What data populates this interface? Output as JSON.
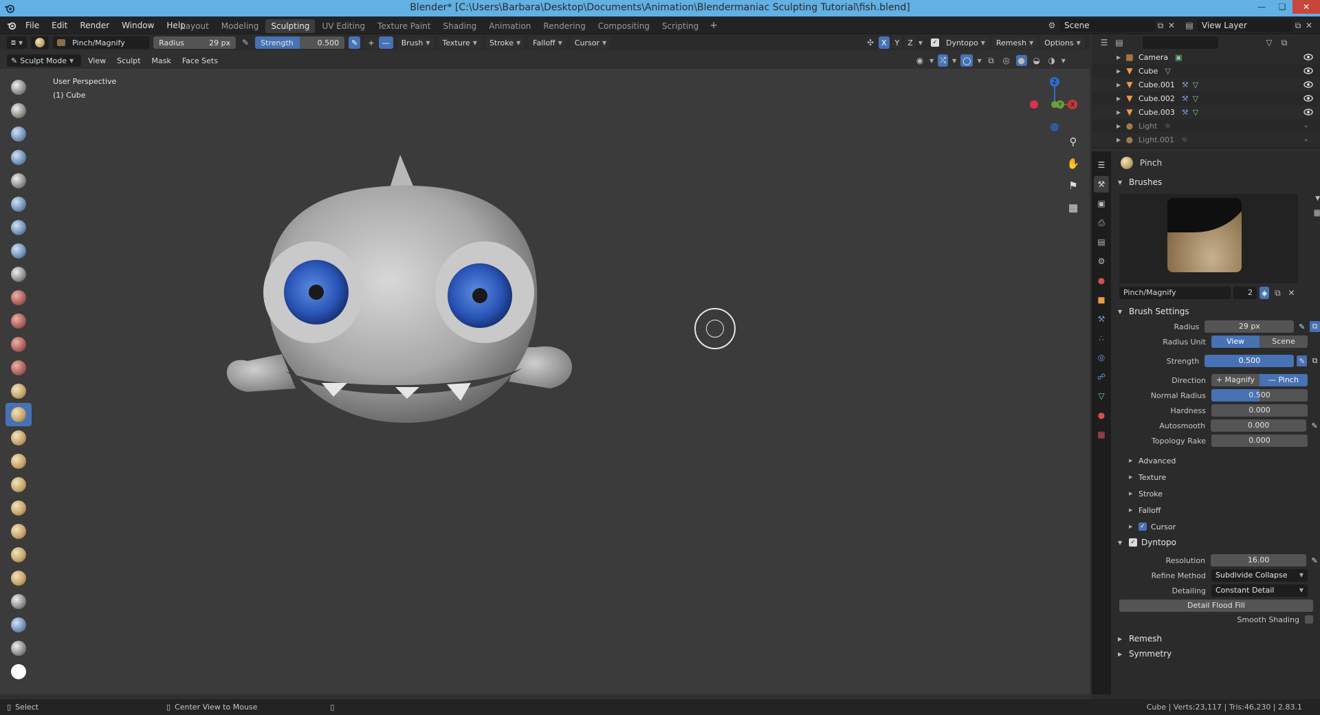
{
  "window": {
    "title": "Blender* [C:\\Users\\Barbara\\Desktop\\Documents\\Animation\\Blendermaniac Sculpting Tutorial\\fish.blend]"
  },
  "menu": [
    "File",
    "Edit",
    "Render",
    "Window",
    "Help"
  ],
  "workspaces": [
    "Layout",
    "Modeling",
    "Sculpting",
    "UV Editing",
    "Texture Paint",
    "Shading",
    "Animation",
    "Rendering",
    "Compositing",
    "Scripting"
  ],
  "active_workspace": "Sculpting",
  "scene": {
    "name": "Scene",
    "view_layer": "View Layer"
  },
  "tool_header": {
    "brush_name": "Pinch/Magnify",
    "radius_label": "Radius",
    "radius_value": "29 px",
    "strength_label": "Strength",
    "strength_value": "0.500",
    "dropdowns": [
      "Brush",
      "Texture",
      "Stroke",
      "Falloff",
      "Cursor"
    ],
    "axes": [
      "X",
      "Y",
      "Z"
    ],
    "dyntopo": "Dyntopo",
    "remesh": "Remesh",
    "options": "Options"
  },
  "mode_header": {
    "mode": "Sculpt Mode",
    "menus": [
      "View",
      "Sculpt",
      "Mask",
      "Face Sets"
    ]
  },
  "viewport": {
    "perspective": "User Perspective",
    "object": "(1) Cube",
    "gizmo_labels": [
      "Z",
      "Y",
      "X"
    ]
  },
  "outliner": {
    "items": [
      {
        "name": "Camera",
        "icon": "camera-icon",
        "dim": false
      },
      {
        "name": "Cube",
        "icon": "mesh-icon",
        "dim": false
      },
      {
        "name": "Cube.001",
        "icon": "mesh-icon",
        "dim": false
      },
      {
        "name": "Cube.002",
        "icon": "mesh-icon",
        "dim": false
      },
      {
        "name": "Cube.003",
        "icon": "mesh-icon",
        "dim": false
      },
      {
        "name": "Light",
        "icon": "light-icon",
        "dim": true
      },
      {
        "name": "Light.001",
        "icon": "light-icon",
        "dim": true
      }
    ]
  },
  "properties": {
    "tool_name": "Pinch",
    "brushes_header": "Brushes",
    "brush_name": "Pinch/Magnify",
    "brush_users": "2",
    "brush_settings_header": "Brush Settings",
    "radius": {
      "label": "Radius",
      "value": "29 px"
    },
    "radius_unit": {
      "label": "Radius Unit",
      "options": [
        "View",
        "Scene"
      ],
      "selected": "View"
    },
    "strength": {
      "label": "Strength",
      "value": "0.500"
    },
    "direction": {
      "label": "Direction",
      "options": [
        "Magnify",
        "Pinch"
      ],
      "selected": "Pinch"
    },
    "normal_radius": {
      "label": "Normal Radius",
      "value": "0.500",
      "fill": 0.5
    },
    "hardness": {
      "label": "Hardness",
      "value": "0.000"
    },
    "autosmooth": {
      "label": "Autosmooth",
      "value": "0.000"
    },
    "topology_rake": {
      "label": "Topology Rake",
      "value": "0.000"
    },
    "subpanels": [
      "Advanced",
      "Texture",
      "Stroke",
      "Falloff"
    ],
    "cursor": "Cursor",
    "dyntopo_header": "Dyntopo",
    "resolution": {
      "label": "Resolution",
      "value": "16.00"
    },
    "refine_method": {
      "label": "Refine Method",
      "value": "Subdivide Collapse"
    },
    "detailing": {
      "label": "Detailing",
      "value": "Constant Detail"
    },
    "detail_flood_fill": "Detail Flood Fill",
    "smooth_shading": "Smooth Shading",
    "remesh_header": "Remesh",
    "symmetry_header": "Symmetry"
  },
  "statusbar": {
    "select": "Select",
    "center_view": "Center View to Mouse",
    "stats": "Cube | Verts:23,117 | Tris:46,230 | 2.83.1"
  },
  "colors": {
    "accent": "#4772b3",
    "titlebar": "#62b0e4"
  }
}
